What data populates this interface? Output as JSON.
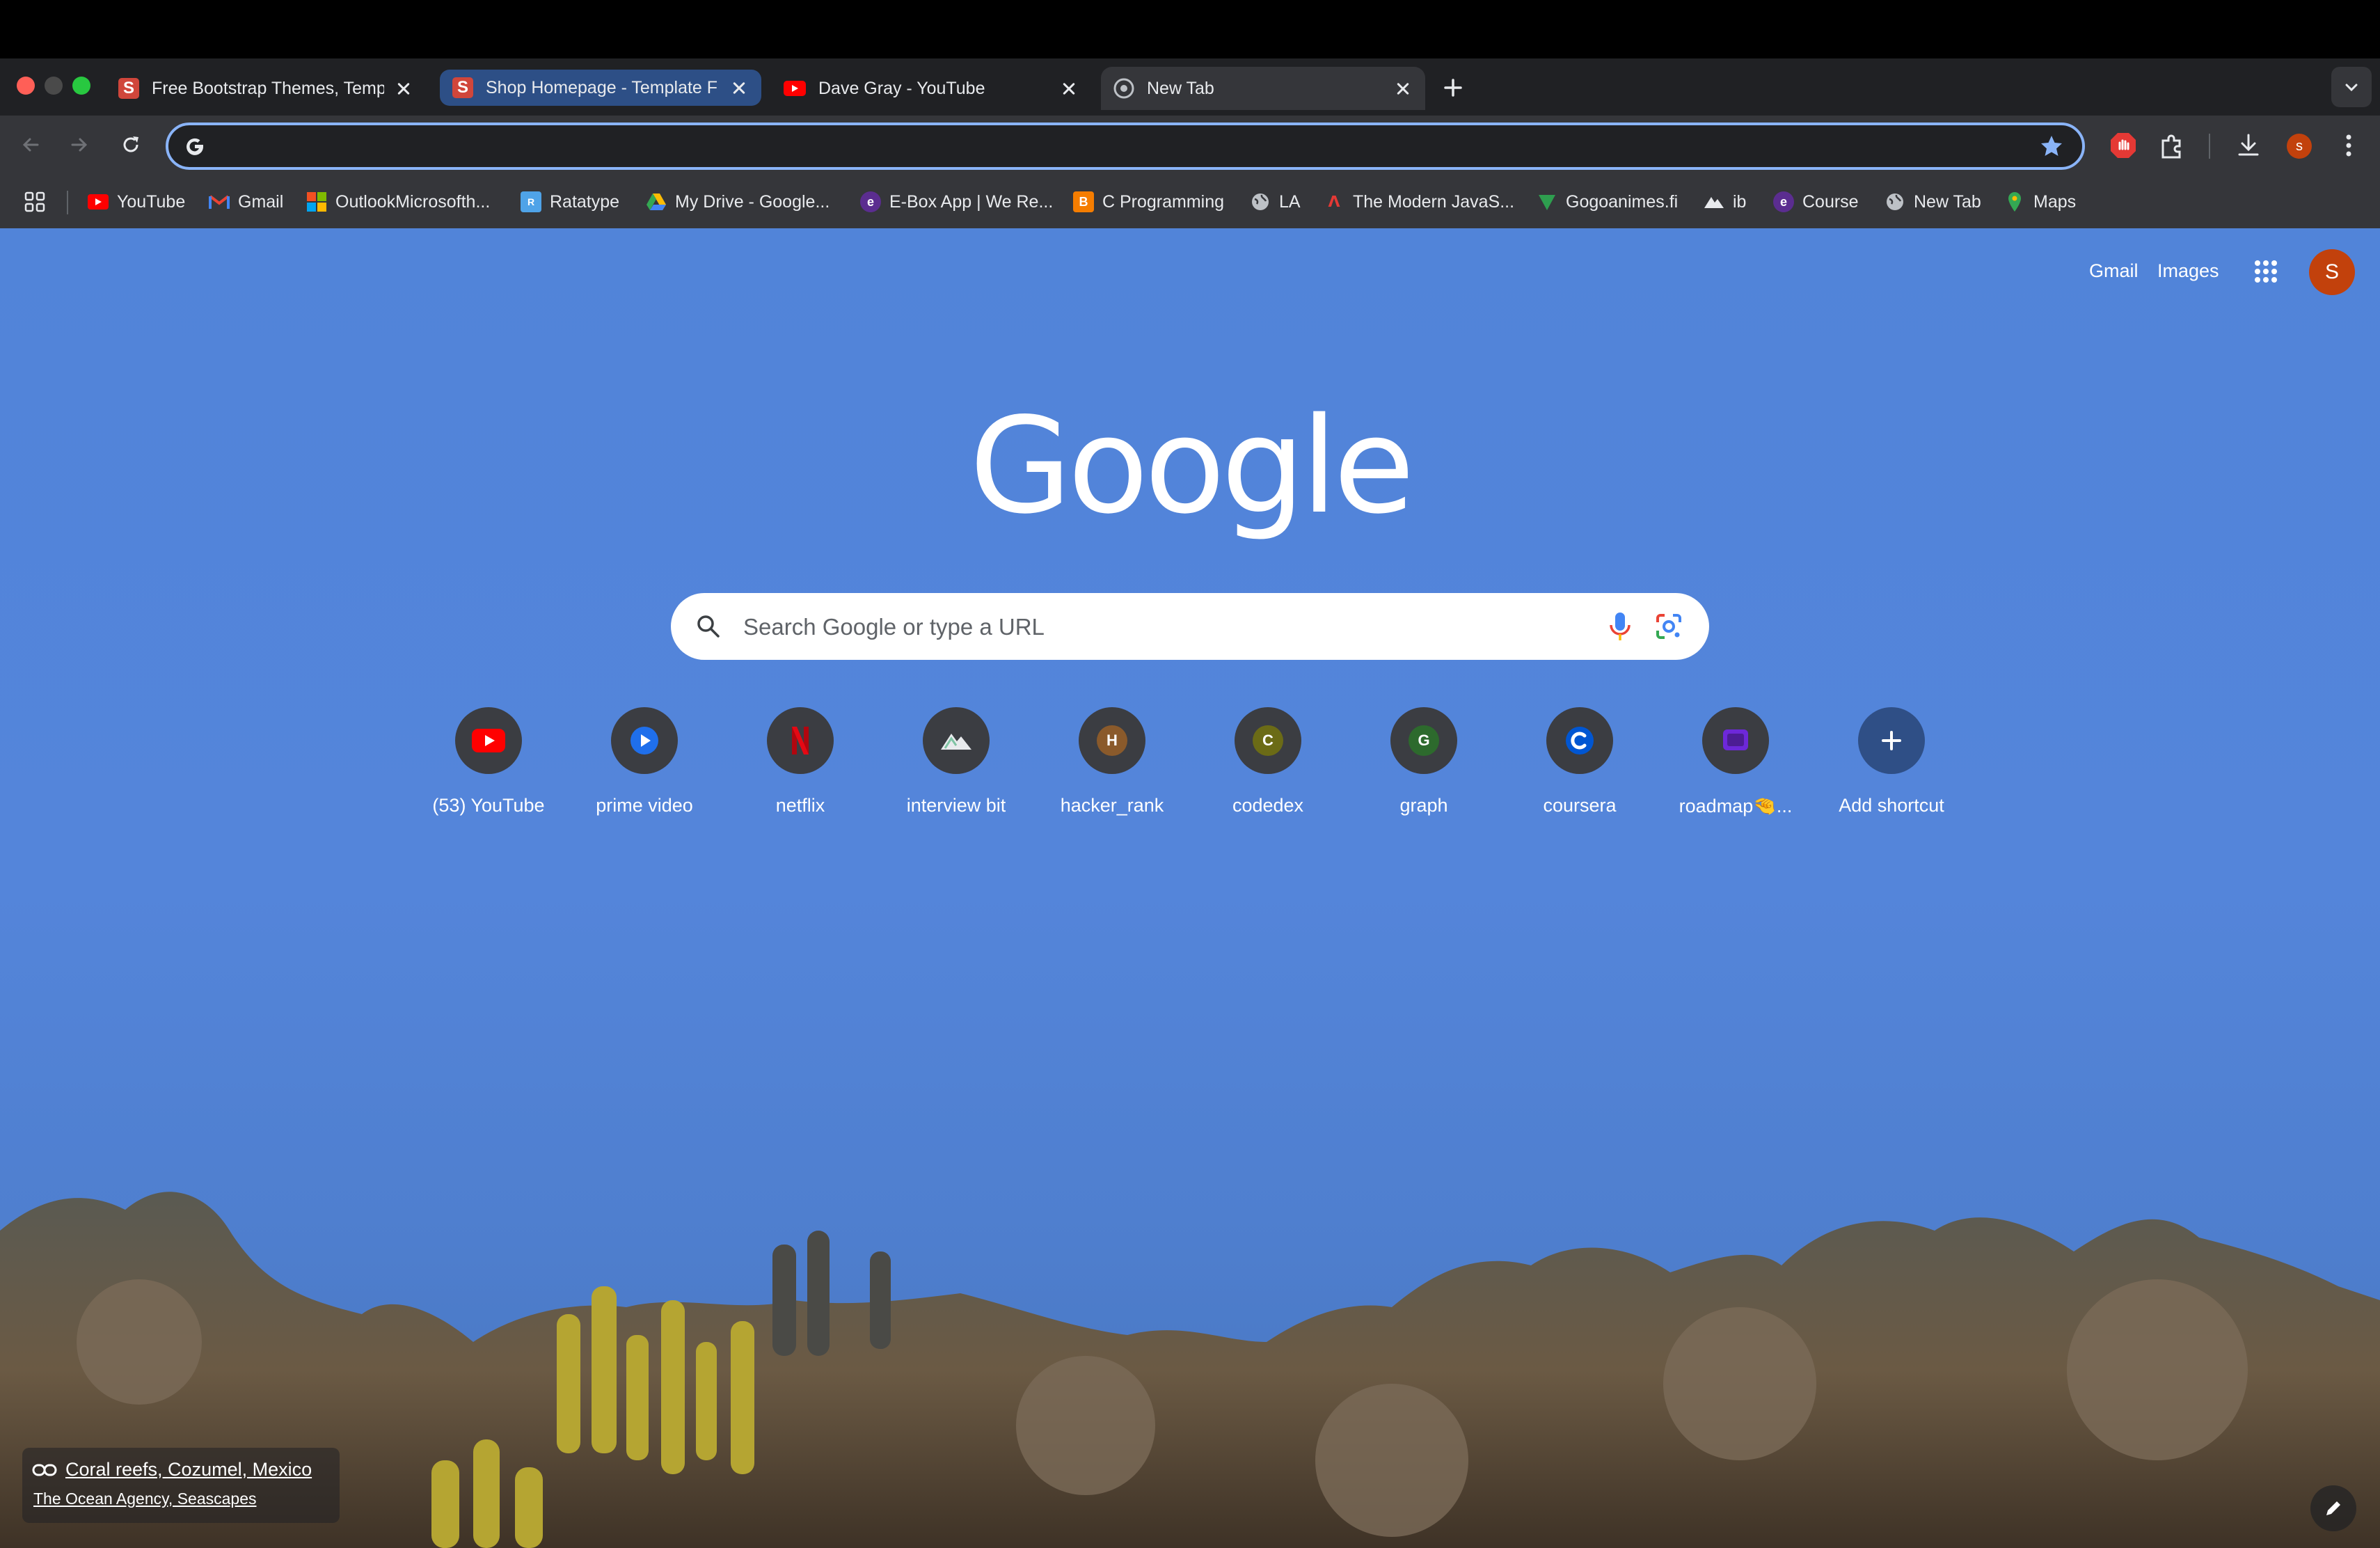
{
  "browser": {
    "tabs": [
      {
        "title": "Free Bootstrap Themes, Temp",
        "favicon": "startbootstrap-icon",
        "active": false
      },
      {
        "title": "Shop Homepage - Template F",
        "favicon": "startbootstrap-icon",
        "active": false,
        "highlighted": true
      },
      {
        "title": "Dave Gray - YouTube",
        "favicon": "youtube-icon",
        "active": false
      },
      {
        "title": "New Tab",
        "favicon": "chrome-icon",
        "active": true
      }
    ],
    "omnibox": {
      "value": "",
      "placeholder": ""
    },
    "profile_initial": "s",
    "bookmarks": [
      {
        "label": "YouTube",
        "icon": "youtube-icon"
      },
      {
        "label": "Gmail",
        "icon": "gmail-icon"
      },
      {
        "label": "OutlookMicrosofth...",
        "icon": "microsoft-icon"
      },
      {
        "label": "Ratatype",
        "icon": "ratatype-icon"
      },
      {
        "label": "My Drive - Google...",
        "icon": "drive-icon"
      },
      {
        "label": "E-Box App | We Re...",
        "icon": "ebox-icon"
      },
      {
        "label": "C Programming",
        "icon": "blogger-icon"
      },
      {
        "label": "LA",
        "icon": "globe-icon"
      },
      {
        "label": "The Modern JavaS...",
        "icon": "js-icon"
      },
      {
        "label": "Gogoanimes.fi",
        "icon": "gogoanime-icon"
      },
      {
        "label": "ib",
        "icon": "interviewbit-icon"
      },
      {
        "label": "Course",
        "icon": "ebox-icon"
      },
      {
        "label": "New Tab",
        "icon": "globe-icon"
      },
      {
        "label": "Maps",
        "icon": "maps-icon"
      }
    ]
  },
  "newtab": {
    "links": {
      "gmail": "Gmail",
      "images": "Images"
    },
    "account_initial": "S",
    "logo_text": "Google",
    "search": {
      "placeholder": "Search Google or type a URL"
    },
    "shortcuts": [
      {
        "label": "(53) YouTube",
        "icon": "youtube-icon"
      },
      {
        "label": "prime video",
        "icon": "prime-video-icon"
      },
      {
        "label": "netflix",
        "icon": "netflix-icon"
      },
      {
        "label": "interview bit",
        "icon": "interviewbit-icon"
      },
      {
        "label": "hacker_rank",
        "letter": "H",
        "color": "#8a5a2b"
      },
      {
        "label": "codedex",
        "letter": "C",
        "color": "#6b6b16"
      },
      {
        "label": "graph",
        "letter": "G",
        "color": "#2d6a2d"
      },
      {
        "label": "coursera",
        "icon": "coursera-icon"
      },
      {
        "label": "roadmap🤏...",
        "icon": "roadmap-icon"
      },
      {
        "label": "Add shortcut",
        "icon": "plus-icon"
      }
    ],
    "attribution": {
      "title": "Coral reefs, Cozumel, Mexico",
      "credit": "The Ocean Agency, Seascapes"
    }
  },
  "colors": {
    "tabstrip": "#202124",
    "toolbar": "#35363a",
    "omnibox_focus": "#8ab4f8",
    "page_bg": "#5184d9"
  }
}
